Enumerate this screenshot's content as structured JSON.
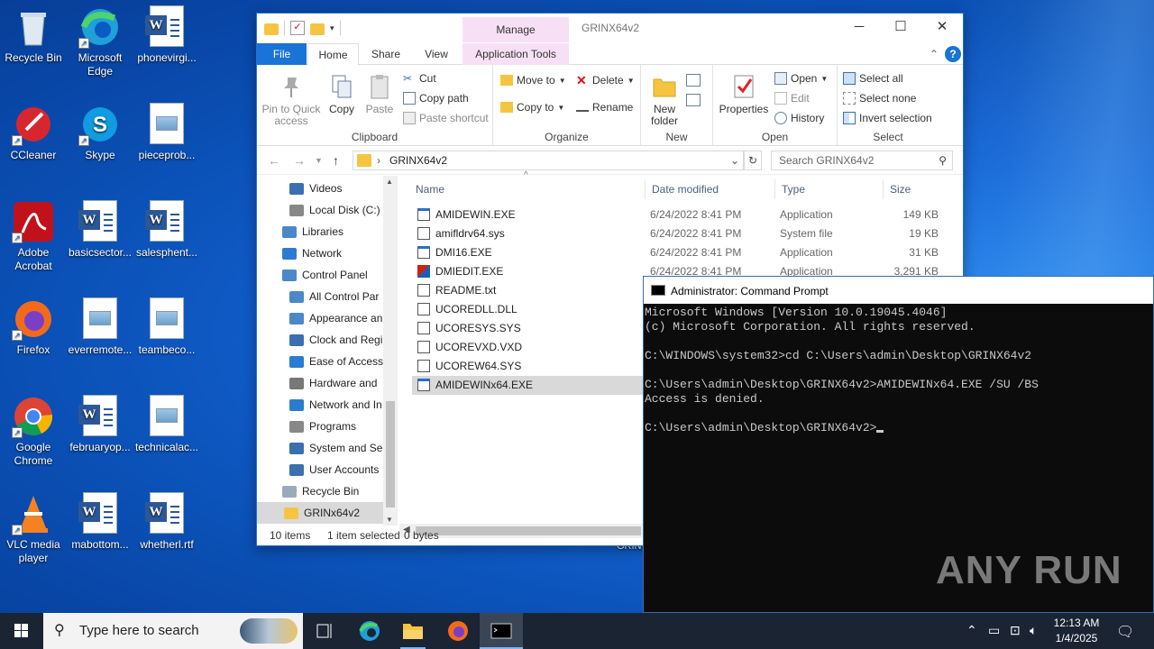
{
  "desktop": {
    "icons": [
      {
        "label": "Recycle Bin",
        "icon": "recycle-bin-icon"
      },
      {
        "label": "Microsoft Edge",
        "icon": "edge-icon"
      },
      {
        "label": "phonevirgi...",
        "icon": "word-doc-icon"
      },
      {
        "label": "CCleaner",
        "icon": "ccleaner-icon"
      },
      {
        "label": "Skype",
        "icon": "skype-icon"
      },
      {
        "label": "pieceprob...",
        "icon": "image-file-icon"
      },
      {
        "label": "Adobe Acrobat",
        "icon": "acrobat-icon"
      },
      {
        "label": "basicsector...",
        "icon": "word-doc-icon"
      },
      {
        "label": "salesphent...",
        "icon": "word-doc-icon"
      },
      {
        "label": "Firefox",
        "icon": "firefox-icon"
      },
      {
        "label": "everremote...",
        "icon": "image-file-icon"
      },
      {
        "label": "teambeco...",
        "icon": "image-file-icon"
      },
      {
        "label": "Google Chrome",
        "icon": "chrome-icon"
      },
      {
        "label": "februaryop...",
        "icon": "word-doc-icon"
      },
      {
        "label": "technicalac...",
        "icon": "image-file-icon"
      },
      {
        "label": "VLC media player",
        "icon": "vlc-icon"
      },
      {
        "label": "mabottom...",
        "icon": "word-doc-icon"
      },
      {
        "label": "whetherl.rtf",
        "icon": "word-doc-icon"
      }
    ],
    "partial_label": "GRIN"
  },
  "explorer": {
    "title": "GRINX64v2",
    "manage_tab": "Manage",
    "tabs": {
      "file": "File",
      "home": "Home",
      "share": "Share",
      "view": "View",
      "app_tools": "Application Tools"
    },
    "ribbon": {
      "clipboard": {
        "label": "Clipboard",
        "pin": "Pin to Quick access",
        "copy": "Copy",
        "paste": "Paste",
        "cut": "Cut",
        "copy_path": "Copy path",
        "paste_shortcut": "Paste shortcut"
      },
      "organize": {
        "label": "Organize",
        "move_to": "Move to",
        "copy_to": "Copy to",
        "delete": "Delete",
        "rename": "Rename"
      },
      "new": {
        "label": "New",
        "new_folder": "New folder"
      },
      "open": {
        "label": "Open",
        "properties": "Properties",
        "open": "Open",
        "edit": "Edit",
        "history": "History"
      },
      "select": {
        "label": "Select",
        "select_all": "Select all",
        "select_none": "Select none",
        "invert": "Invert selection"
      }
    },
    "address": {
      "crumb": "GRINX64v2",
      "search_placeholder": "Search GRINX64v2"
    },
    "nav": [
      {
        "label": "Videos",
        "indent": 1
      },
      {
        "label": "Local Disk (C:)",
        "indent": 1
      },
      {
        "label": "Libraries",
        "indent": 0
      },
      {
        "label": "Network",
        "indent": 0
      },
      {
        "label": "Control Panel",
        "indent": 0
      },
      {
        "label": "All Control Par",
        "indent": 1
      },
      {
        "label": "Appearance an",
        "indent": 1
      },
      {
        "label": "Clock and Regi",
        "indent": 1
      },
      {
        "label": "Ease of Access",
        "indent": 1
      },
      {
        "label": "Hardware and",
        "indent": 1
      },
      {
        "label": "Network and In",
        "indent": 1
      },
      {
        "label": "Programs",
        "indent": 1
      },
      {
        "label": "System and Sec",
        "indent": 1
      },
      {
        "label": "User Accounts",
        "indent": 1
      },
      {
        "label": "Recycle Bin",
        "indent": 0
      },
      {
        "label": "GRINx64v2",
        "indent": 0
      }
    ],
    "columns": {
      "name": "Name",
      "date": "Date modified",
      "type": "Type",
      "size": "Size"
    },
    "files": [
      {
        "name": "AMIDEWIN.EXE",
        "date": "6/24/2022 8:41 PM",
        "type": "Application",
        "size": "149 KB"
      },
      {
        "name": "amifldrv64.sys",
        "date": "6/24/2022 8:41 PM",
        "type": "System file",
        "size": "19 KB"
      },
      {
        "name": "DMI16.EXE",
        "date": "6/24/2022 8:41 PM",
        "type": "Application",
        "size": "31 KB"
      },
      {
        "name": "DMIEDIT.EXE",
        "date": "6/24/2022 8:41 PM",
        "type": "Application",
        "size": "3,291 KB"
      },
      {
        "name": "README.txt",
        "date": "",
        "type": "",
        "size": ""
      },
      {
        "name": "UCOREDLL.DLL",
        "date": "",
        "type": "",
        "size": ""
      },
      {
        "name": "UCORESYS.SYS",
        "date": "",
        "type": "",
        "size": ""
      },
      {
        "name": "UCOREVXD.VXD",
        "date": "",
        "type": "",
        "size": ""
      },
      {
        "name": "UCOREW64.SYS",
        "date": "",
        "type": "",
        "size": ""
      },
      {
        "name": "AMIDEWINx64.EXE",
        "date": "",
        "type": "",
        "size": ""
      }
    ],
    "status": {
      "items": "10 items",
      "selected": "1 item selected",
      "bytes": "0 bytes"
    }
  },
  "cmd": {
    "title": "Administrator: Command Prompt",
    "lines": "Microsoft Windows [Version 10.0.19045.4046]\n(c) Microsoft Corporation. All rights reserved.\n\nC:\\WINDOWS\\system32>cd C:\\Users\\admin\\Desktop\\GRINX64v2\n\nC:\\Users\\admin\\Desktop\\GRINX64v2>AMIDEWINx64.EXE /SU /BS\nAccess is denied.\n\nC:\\Users\\admin\\Desktop\\GRINX64v2>"
  },
  "watermark": "ANY RUN",
  "taskbar": {
    "search_placeholder": "Type here to search",
    "time": "12:13 AM",
    "date": "1/4/2025"
  },
  "colors": {
    "accent": "#1a73d6",
    "manage_tab": "#f7e0f5",
    "taskbar": "#1b2433",
    "console_bg": "#0c0c0c"
  }
}
